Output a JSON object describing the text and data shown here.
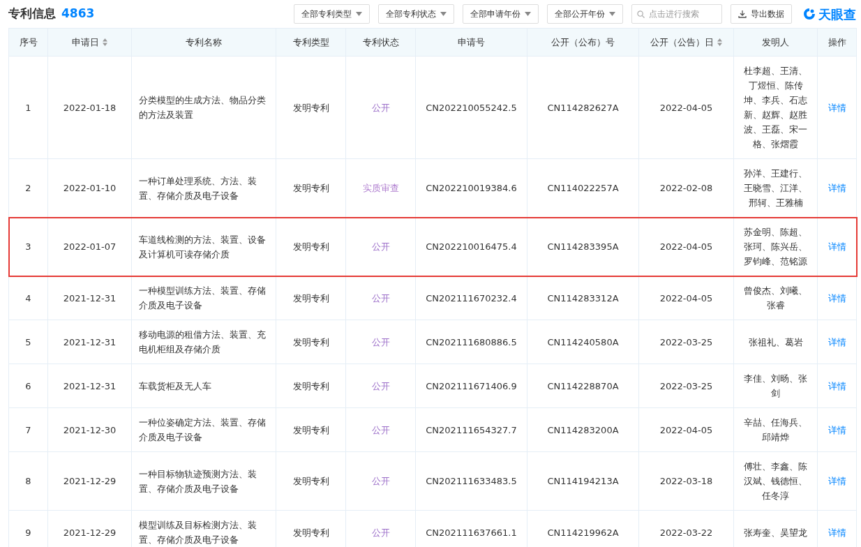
{
  "header": {
    "title": "专利信息",
    "count": "4863",
    "filters": [
      "全部专利类型",
      "全部专利状态",
      "全部申请年份",
      "全部公开年份"
    ],
    "search": {
      "placeholder": "点击进行搜索"
    },
    "export_button": "导出数据",
    "logo": "天眼查"
  },
  "table": {
    "columns": [
      {
        "label": "序号",
        "sortable": false
      },
      {
        "label": "申请日",
        "sortable": true
      },
      {
        "label": "专利名称",
        "sortable": false
      },
      {
        "label": "专利类型",
        "sortable": false
      },
      {
        "label": "专利状态",
        "sortable": false
      },
      {
        "label": "申请号",
        "sortable": false
      },
      {
        "label": "公开（公布）号",
        "sortable": false
      },
      {
        "label": "公开（公告）日",
        "sortable": true
      },
      {
        "label": "发明人",
        "sortable": false
      },
      {
        "label": "操作",
        "sortable": false
      }
    ],
    "rows": [
      {
        "no": "1",
        "date": "2022-01-18",
        "name": "分类模型的生成方法、物品分类的方法及装置",
        "type": "发明专利",
        "status": "公开",
        "app_no": "CN202210055242.5",
        "pub_no": "CN114282627A",
        "pub_date": "2022-04-05",
        "inventors": "杜李超、王清、丁煜恒、陈传坤、李兵、石志新、赵辉、赵胜波、王磊、宋一格、张熠霞",
        "action": "详情",
        "highlighted": false
      },
      {
        "no": "2",
        "date": "2022-01-10",
        "name": "一种订单处理系统、方法、装置、存储介质及电子设备",
        "type": "发明专利",
        "status": "实质审查",
        "app_no": "CN202210019384.6",
        "pub_no": "CN114022257A",
        "pub_date": "2022-02-08",
        "inventors": "孙洋、王建行、王晓雪、江洋、邢轲、王雅楠",
        "action": "详情",
        "highlighted": false
      },
      {
        "no": "3",
        "date": "2022-01-07",
        "name": "车道线检测的方法、装置、设备及计算机可读存储介质",
        "type": "发明专利",
        "status": "公开",
        "app_no": "CN202210016475.4",
        "pub_no": "CN114283395A",
        "pub_date": "2022-04-05",
        "inventors": "苏金明、陈超、张珂、陈兴岳、罗钧峰、范铭源",
        "action": "详情",
        "highlighted": true
      },
      {
        "no": "4",
        "date": "2021-12-31",
        "name": "一种模型训练方法、装置、存储介质及电子设备",
        "type": "发明专利",
        "status": "公开",
        "app_no": "CN202111670232.4",
        "pub_no": "CN114283312A",
        "pub_date": "2022-04-05",
        "inventors": "曾俊杰、刘曦、张睿",
        "action": "详情",
        "highlighted": false
      },
      {
        "no": "5",
        "date": "2021-12-31",
        "name": "移动电源的租借方法、装置、充电机柜组及存储介质",
        "type": "发明专利",
        "status": "公开",
        "app_no": "CN202111680886.5",
        "pub_no": "CN114240580A",
        "pub_date": "2022-03-25",
        "inventors": "张祖礼、葛岩",
        "action": "详情",
        "highlighted": false
      },
      {
        "no": "6",
        "date": "2021-12-31",
        "name": "车载货柜及无人车",
        "type": "发明专利",
        "status": "公开",
        "app_no": "CN202111671406.9",
        "pub_no": "CN114228870A",
        "pub_date": "2022-03-25",
        "inventors": "李佳、刘旸、张剑",
        "action": "详情",
        "highlighted": false
      },
      {
        "no": "7",
        "date": "2021-12-30",
        "name": "一种位姿确定方法、装置、存储介质及电子设备",
        "type": "发明专利",
        "status": "公开",
        "app_no": "CN202111654327.7",
        "pub_no": "CN114283200A",
        "pub_date": "2022-04-05",
        "inventors": "辛喆、任海兵、邱靖烨",
        "action": "详情",
        "highlighted": false
      },
      {
        "no": "8",
        "date": "2021-12-29",
        "name": "一种目标物轨迹预测方法、装置、存储介质及电子设备",
        "type": "发明专利",
        "status": "公开",
        "app_no": "CN202111633483.5",
        "pub_no": "CN114194213A",
        "pub_date": "2022-03-18",
        "inventors": "傅壮、李鑫、陈汉斌、钱德恒、任冬淳",
        "action": "详情",
        "highlighted": false
      },
      {
        "no": "9",
        "date": "2021-12-29",
        "name": "模型训练及目标检测方法、装置、存储介质及电子设备",
        "type": "发明专利",
        "status": "公开",
        "app_no": "CN202111637661.1",
        "pub_no": "CN114219962A",
        "pub_date": "2022-03-22",
        "inventors": "张寿奎、吴望龙",
        "action": "详情",
        "highlighted": false
      }
    ]
  }
}
